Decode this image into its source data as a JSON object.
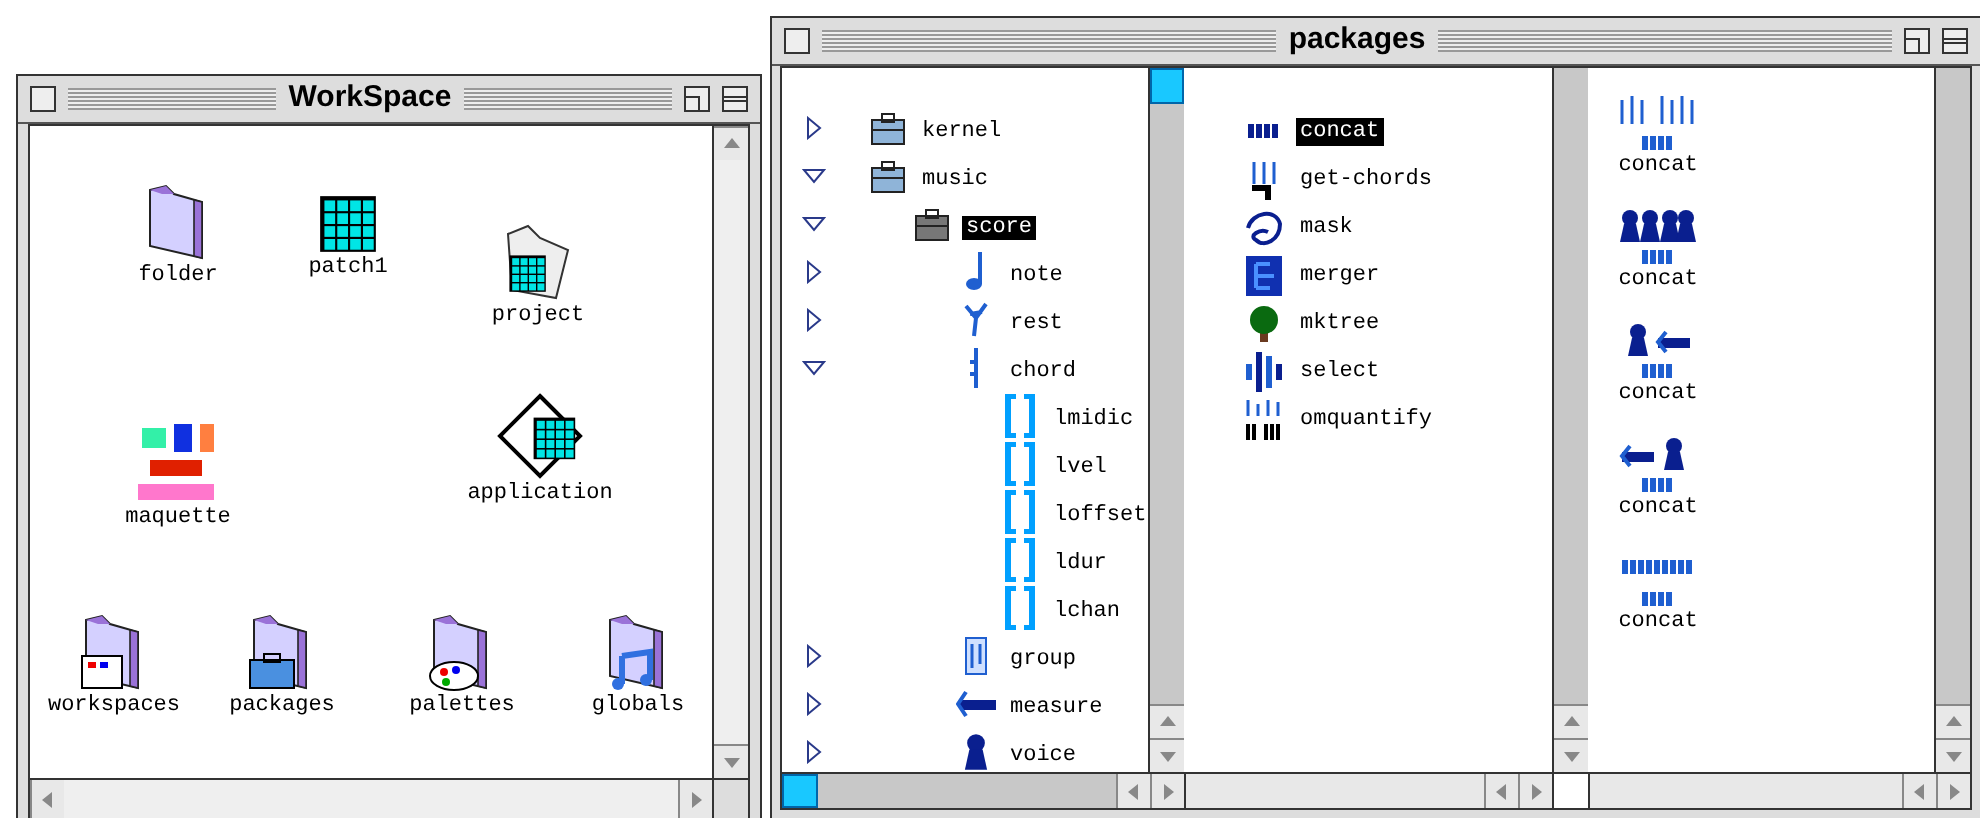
{
  "workspace": {
    "title": "WorkSpace",
    "icons": [
      {
        "label": "folder",
        "kind": "folder"
      },
      {
        "label": "patch1",
        "kind": "patch"
      },
      {
        "label": "project",
        "kind": "project"
      },
      {
        "label": "maquette",
        "kind": "maquette"
      },
      {
        "label": "application",
        "kind": "application"
      },
      {
        "label": "workspaces",
        "kind": "workspaces"
      },
      {
        "label": "packages",
        "kind": "packages"
      },
      {
        "label": "palettes",
        "kind": "palettes"
      },
      {
        "label": "globals",
        "kind": "globals"
      }
    ]
  },
  "packages": {
    "title": "packages",
    "tree": [
      {
        "label": "kernel",
        "kind": "package",
        "expanded": false,
        "selected": false
      },
      {
        "label": "music",
        "kind": "package",
        "expanded": true,
        "selected": false,
        "children": [
          {
            "label": "score",
            "kind": "package-dark",
            "expanded": true,
            "selected": true,
            "children": [
              {
                "label": "note",
                "kind": "note",
                "expanded": false,
                "selected": false
              },
              {
                "label": "rest",
                "kind": "rest",
                "expanded": false,
                "selected": false
              },
              {
                "label": "chord",
                "kind": "chord",
                "expanded": true,
                "selected": false,
                "children": [
                  {
                    "label": "lmidic",
                    "kind": "slot",
                    "selected": false
                  },
                  {
                    "label": "lvel",
                    "kind": "slot",
                    "selected": false
                  },
                  {
                    "label": "loffset",
                    "kind": "slot",
                    "selected": false
                  },
                  {
                    "label": "ldur",
                    "kind": "slot",
                    "selected": false
                  },
                  {
                    "label": "lchan",
                    "kind": "slot",
                    "selected": false
                  }
                ]
              },
              {
                "label": "group",
                "kind": "group",
                "expanded": false,
                "selected": false
              },
              {
                "label": "measure",
                "kind": "measure",
                "expanded": false,
                "selected": false
              },
              {
                "label": "voice",
                "kind": "voice",
                "expanded": false,
                "selected": false
              }
            ]
          }
        ]
      }
    ],
    "methods": [
      {
        "label": "concat",
        "kind": "bars",
        "selected": true
      },
      {
        "label": "get-chords",
        "kind": "chords",
        "selected": false
      },
      {
        "label": "mask",
        "kind": "mask",
        "selected": false
      },
      {
        "label": "merger",
        "kind": "merger",
        "selected": false
      },
      {
        "label": "mktree",
        "kind": "tree",
        "selected": false
      },
      {
        "label": "select",
        "kind": "select",
        "selected": false
      },
      {
        "label": "omquantify",
        "kind": "quantify",
        "selected": false
      }
    ],
    "variants": [
      {
        "label": "concat",
        "kind": "chords-chords"
      },
      {
        "label": "concat",
        "kind": "voices-voices"
      },
      {
        "label": "concat",
        "kind": "voice-measure"
      },
      {
        "label": "concat",
        "kind": "measure-voice"
      },
      {
        "label": "concat",
        "kind": "bars-bars"
      }
    ]
  }
}
